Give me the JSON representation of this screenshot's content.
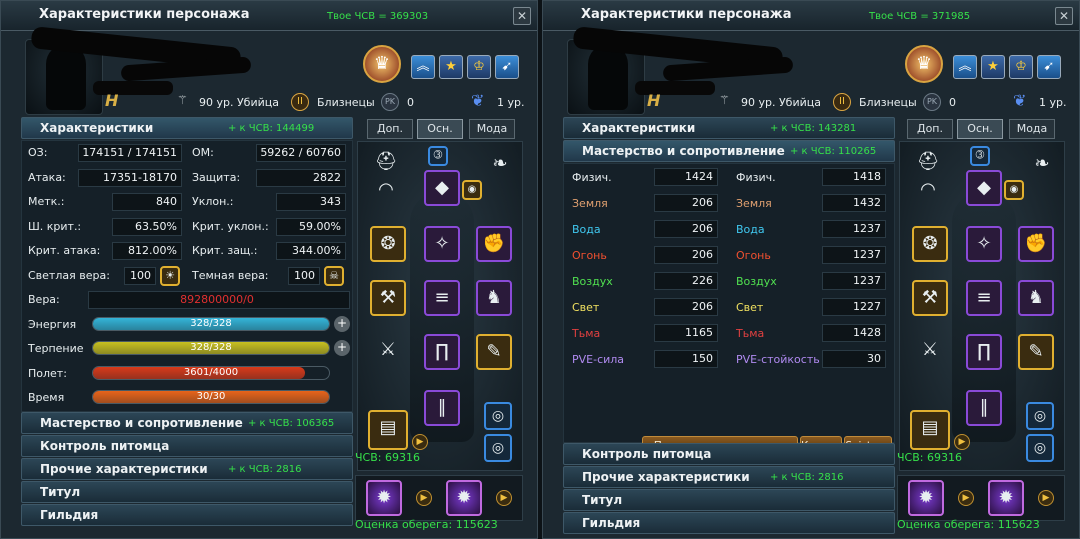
{
  "left": {
    "title": "Характеристики персонажа",
    "csv_label": "Твое ЧСВ = 369303",
    "level_text": "90 ур. Убийца",
    "sign_text": "Близнецы",
    "pk_label": "PK",
    "pk_value": "0",
    "wing_level": "1 ур.",
    "tabs": [
      "Доп.",
      "Осн.",
      "Мода"
    ],
    "active_tab": "Осн.",
    "sections": {
      "stats": {
        "title": "Характеристики",
        "bonus": "+ к ЧСВ: 144499"
      },
      "mastery": {
        "title": "Мастерство и сопротивление",
        "bonus": "+ к ЧСВ: 106365"
      },
      "pet": {
        "title": "Контроль питомца"
      },
      "other": {
        "title": "Прочие характеристики",
        "bonus": "+ к ЧСВ: 2816"
      },
      "title_sec": {
        "title": "Титул"
      },
      "guild": {
        "title": "Гильдия"
      }
    },
    "stats": {
      "hp_label": "ОЗ:",
      "hp": "174151 / 174151",
      "mp_label": "ОМ:",
      "mp": "59262 / 60760",
      "atk_label": "Атака:",
      "atk": "17351-18170",
      "def_label": "Защита:",
      "def": "2822",
      "acc_label": "Метк.:",
      "acc": "840",
      "eva_label": "Уклон.:",
      "eva": "343",
      "crit_label": "Ш. крит.:",
      "crit": "63.50%",
      "critevade_label": "Крит. уклон.:",
      "critevade": "59.00%",
      "critdmg_label": "Крит. атака:",
      "critdmg": "812.00%",
      "critdef_label": "Крит. защ.:",
      "critdef": "344.00%",
      "light_label": "Светлая вера:",
      "light": "100",
      "dark_label": "Темная вера:",
      "dark": "100",
      "faith_label": "Вера:",
      "faith": "892800000/0"
    },
    "bars": {
      "energy": {
        "label": "Энергия",
        "text": "328/328",
        "fraction": 1.0,
        "color": "#34b4d8"
      },
      "patience": {
        "label": "Терпение",
        "text": "328/328",
        "fraction": 1.0,
        "color": "#c8c020"
      },
      "flight": {
        "label": "Полет:",
        "text": "3601/4000",
        "fraction": 0.9,
        "color": "#d83a1a"
      },
      "time": {
        "label": "Время",
        "text": "30/30",
        "fraction": 1.0,
        "color": "#e8641a"
      }
    },
    "equip_score": "ЧСВ: 69316",
    "charm_score": "Оценка оберега: 115623"
  },
  "right": {
    "title": "Характеристики персонажа",
    "csv_label": "Твое ЧСВ = 371985",
    "level_text": "90 ур. Убийца",
    "sign_text": "Близнецы",
    "pk_label": "PK",
    "pk_value": "0",
    "wing_level": "1 ур.",
    "tabs": [
      "Доп.",
      "Осн.",
      "Мода"
    ],
    "active_tab": "Осн.",
    "sections": {
      "stats": {
        "title": "Характеристики",
        "bonus": "+ к ЧСВ: 143281"
      },
      "mastery": {
        "title": "Мастерство и сопротивление",
        "bonus": "+ к ЧСВ: 110265"
      },
      "pet": {
        "title": "Контроль питомца"
      },
      "other": {
        "title": "Прочие характеристики",
        "bonus": "+ к ЧСВ: 2816"
      },
      "title_sec": {
        "title": "Титул"
      },
      "guild": {
        "title": "Гильдия"
      }
    },
    "mastery_rows": [
      {
        "l_label": "Физич.",
        "l_val": "1424",
        "r_label": "Физич.",
        "r_val": "1418",
        "color": "#e8eef0"
      },
      {
        "l_label": "Земля",
        "l_val": "206",
        "r_label": "Земля",
        "r_val": "1432",
        "color": "#e0a070"
      },
      {
        "l_label": "Вода",
        "l_val": "206",
        "r_label": "Вода",
        "r_val": "1237",
        "color": "#40c8f0"
      },
      {
        "l_label": "Огонь",
        "l_val": "206",
        "r_label": "Огонь",
        "r_val": "1237",
        "color": "#f05030"
      },
      {
        "l_label": "Воздух",
        "l_val": "226",
        "r_label": "Воздух",
        "r_val": "1237",
        "color": "#50e050"
      },
      {
        "l_label": "Свет",
        "l_val": "206",
        "r_label": "Свет",
        "r_val": "1227",
        "color": "#f0e060"
      },
      {
        "l_label": "Тьма",
        "l_val": "1165",
        "r_label": "Тьма",
        "r_val": "1428",
        "color": "#e04040"
      },
      {
        "l_label": "PVE-сила",
        "l_val": "150",
        "r_label": "PVE-стойкость",
        "r_val": "30",
        "color": "#b08af0"
      }
    ],
    "buttons": {
      "mastery_up": "Повышение мастерства",
      "crystal": "Кристалл",
      "seistone": "Seistone"
    },
    "equip_score": "ЧСВ: 69316",
    "charm_score": "Оценка оберега: 115623"
  },
  "icons": [
    "crest-icon",
    "wing-rank-icon",
    "star-icon",
    "cup-icon",
    "horn-icon",
    "h-rank-icon",
    "gemini-icon",
    "pk-icon",
    "wings-icon",
    "close-icon"
  ]
}
